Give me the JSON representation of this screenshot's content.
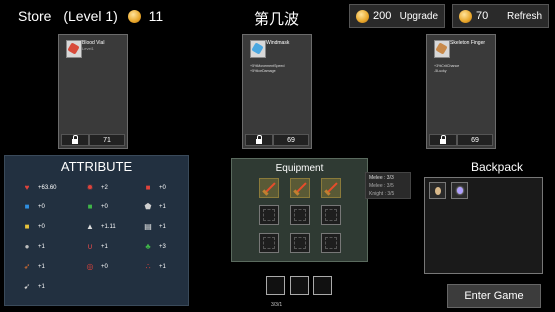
{
  "header": {
    "store_title": "Store",
    "store_level": "(Level 1)",
    "coins": "11",
    "wave_title": "第几波"
  },
  "upgrade_button": {
    "cost": "200",
    "label": "Upgrade"
  },
  "refresh_button": {
    "cost": "70",
    "label": "Refresh"
  },
  "shop_cards": [
    {
      "name": "Blood Vial",
      "sub": "Level1",
      "desc": [
        "",
        ""
      ],
      "price": "71",
      "icon_color": "#d84a3a",
      "icon": "blood-vial-icon"
    },
    {
      "name": "Windmask",
      "sub": "",
      "desc": [
        "+5%MovementSpeed",
        "+5%IceDamage"
      ],
      "price": "69",
      "icon_color": "#4aa7e0",
      "icon": "windmask-icon"
    },
    {
      "name": "Skeleton Finger",
      "sub": "",
      "desc": [
        "+3%CritChance",
        "-5Lucky"
      ],
      "price": "69",
      "icon_color": "#c98a4a",
      "icon": "skeleton-finger-icon"
    }
  ],
  "attribute": {
    "title": "ATTRIBUTE",
    "stats": [
      {
        "value": "+63.60",
        "color": "#e0433b",
        "icon": "heart-icon",
        "glyph": "♥"
      },
      {
        "value": "+2",
        "color": "#e0433b",
        "icon": "regen-icon",
        "glyph": "✹"
      },
      {
        "value": "+0",
        "color": "#e0433b",
        "icon": "red-fist-icon",
        "glyph": "■"
      },
      {
        "value": "+0",
        "color": "#2f8ee0",
        "icon": "blue-fist-icon",
        "glyph": "■"
      },
      {
        "value": "+0",
        "color": "#3fb548",
        "icon": "green-fist-icon",
        "glyph": "■"
      },
      {
        "value": "+1",
        "color": "#cfcfcf",
        "icon": "armor-icon",
        "glyph": "⬟"
      },
      {
        "value": "+0",
        "color": "#e8c23a",
        "icon": "yellow-fist-icon",
        "glyph": "■"
      },
      {
        "value": "+1.11",
        "color": "#dcdcdc",
        "icon": "boot-icon",
        "glyph": "▲"
      },
      {
        "value": "+1",
        "color": "#e8e8e8",
        "icon": "document-icon",
        "glyph": "▤"
      },
      {
        "value": "+1",
        "color": "#bdbdbd",
        "icon": "group-icon",
        "glyph": "●"
      },
      {
        "value": "+1",
        "color": "#e24a4a",
        "icon": "magnet-icon",
        "glyph": "∪"
      },
      {
        "value": "+3",
        "color": "#3fb548",
        "icon": "clover-icon",
        "glyph": "♣"
      },
      {
        "value": "+1",
        "color": "#e07030",
        "icon": "crit-arrow-icon",
        "glyph": "➶"
      },
      {
        "value": "+0",
        "color": "#e0433b",
        "icon": "target-icon",
        "glyph": "◎"
      },
      {
        "value": "+1",
        "color": "#e0433b",
        "icon": "dots-icon",
        "glyph": "∴"
      },
      {
        "value": "+1",
        "color": "#d0d0d0",
        "icon": "feather-icon",
        "glyph": "➹"
      }
    ]
  },
  "equipment": {
    "title": "Equipment"
  },
  "equip_counts": [
    "Melee : 3/3",
    "Melee : 3/5",
    "Knight : 3/5"
  ],
  "backpack": {
    "title": "Backpack"
  },
  "page_indicator": "3/3/1",
  "enter_button": "Enter Game"
}
